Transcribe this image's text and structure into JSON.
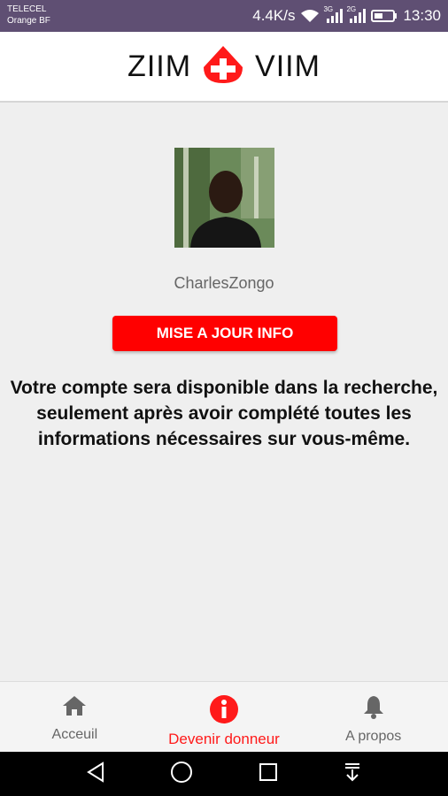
{
  "status_bar": {
    "carrier1": "TELECEL",
    "carrier2": "Orange BF",
    "network_speed": "4.4K/s",
    "sim1_type": "3G",
    "sim2_type": "2G",
    "time": "13:30"
  },
  "header": {
    "brand_left": "ZIIM",
    "brand_right": "VIIM",
    "brand_color": "#ff1a1a"
  },
  "profile": {
    "username": "CharlesZongo"
  },
  "actions": {
    "update_label": "MISE A JOUR INFO"
  },
  "notice": {
    "text": "Votre compte sera disponible dans la recherche, seulement après avoir complété toutes les informations nécessaires sur vous-même."
  },
  "bottom_nav": {
    "items": [
      {
        "label": "Acceuil",
        "icon": "home-icon"
      },
      {
        "label": "Devenir donneur",
        "icon": "info-icon",
        "active": true
      },
      {
        "label": "A propos",
        "icon": "bell-icon"
      }
    ]
  },
  "system_nav": {
    "icons": [
      "back-icon",
      "home-circle-icon",
      "recents-icon",
      "notification-pull-icon"
    ]
  }
}
